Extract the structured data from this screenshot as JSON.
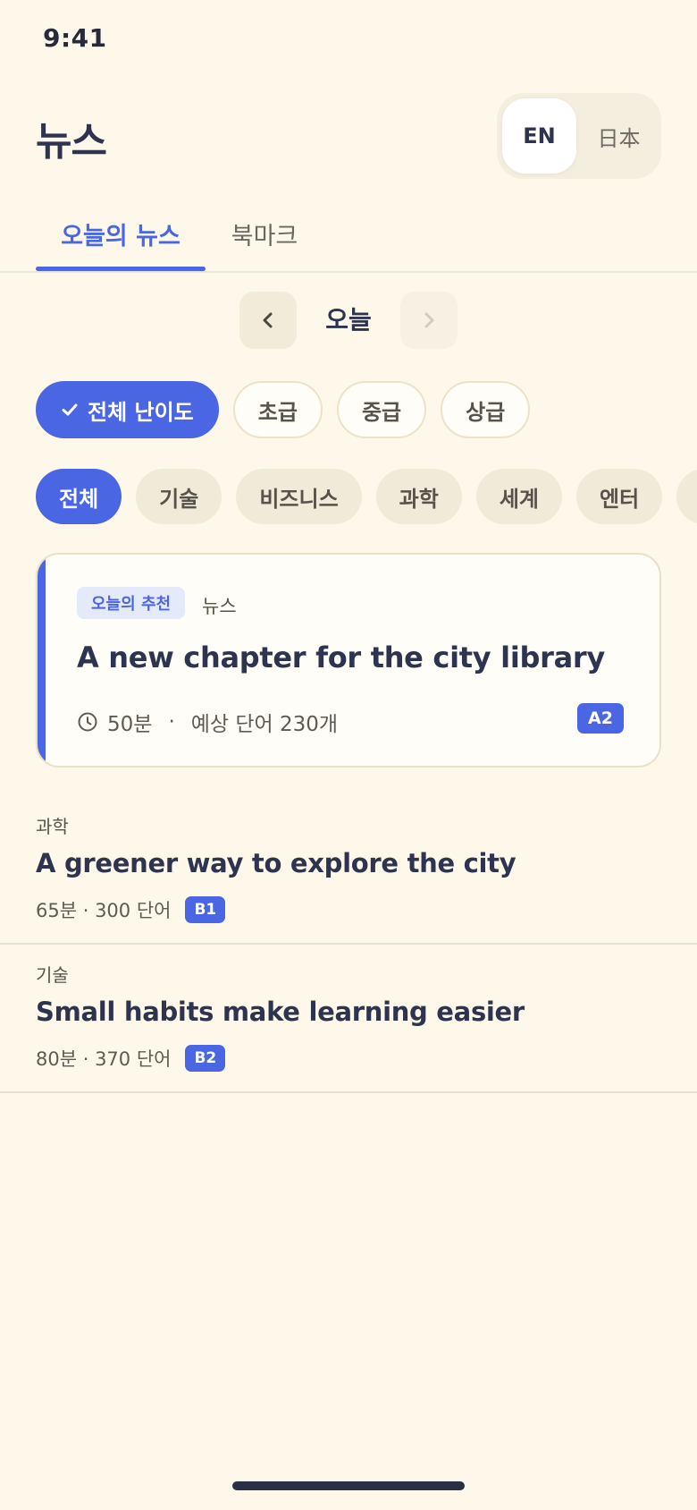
{
  "status_bar": {
    "time": "9:41"
  },
  "header": {
    "title": "뉴스",
    "languages": [
      {
        "label": "EN",
        "active": true
      },
      {
        "label": "日本",
        "active": false
      }
    ]
  },
  "tabs": [
    {
      "label": "오늘의 뉴스",
      "active": true
    },
    {
      "label": "북마크",
      "active": false
    }
  ],
  "date_nav": {
    "label": "오늘",
    "prev_icon": "chevron-left-icon",
    "next_icon": "chevron-right-icon",
    "next_disabled": true
  },
  "levels": [
    {
      "label": "전체 난이도",
      "active": true,
      "icon": "check-icon"
    },
    {
      "label": "초급",
      "active": false
    },
    {
      "label": "중급",
      "active": false
    },
    {
      "label": "상급",
      "active": false
    }
  ],
  "categories": [
    {
      "label": "전체",
      "active": true
    },
    {
      "label": "기술",
      "active": false
    },
    {
      "label": "비즈니스",
      "active": false
    },
    {
      "label": "과학",
      "active": false
    },
    {
      "label": "세계",
      "active": false
    },
    {
      "label": "엔터",
      "active": false
    },
    {
      "label": "",
      "active": false
    }
  ],
  "featured": {
    "badge": "오늘의 추천",
    "kicker": "뉴스",
    "title": "A new chapter for the city library",
    "duration": "50분",
    "separator": "·",
    "words": "예상 단어 230개",
    "level": "A2",
    "icon": "clock-icon"
  },
  "articles": [
    {
      "category": "과학",
      "title": "A greener way to explore the city",
      "meta": "65분 · 300 단어",
      "level": "B1"
    },
    {
      "category": "기술",
      "title": "Small habits make learning easier",
      "meta": "80분 · 370 단어",
      "level": "B2"
    }
  ],
  "colors": {
    "accent": "#4A66E3",
    "background": "#FEF8EA",
    "text": "#2E3450"
  }
}
